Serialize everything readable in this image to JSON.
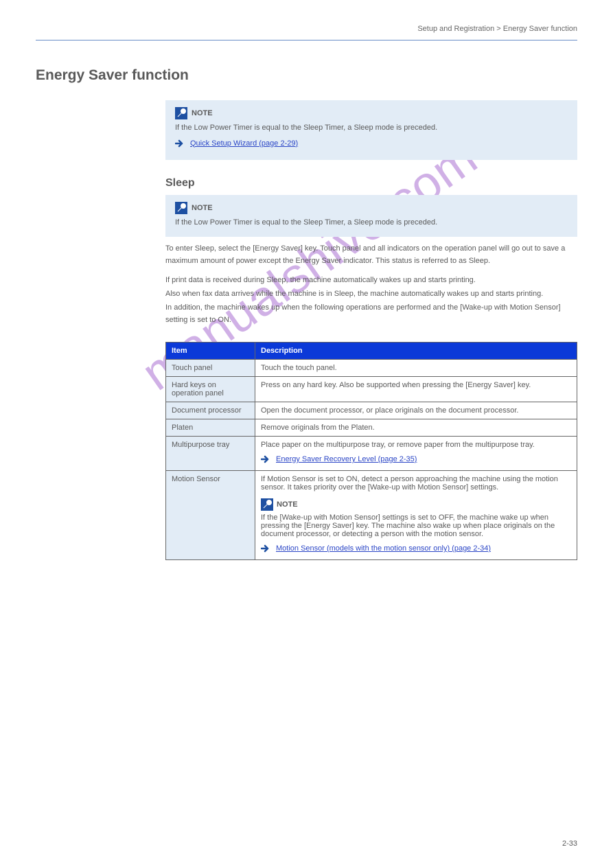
{
  "top_right": "Setup and Registration > Energy Saver function",
  "page_heading": "Energy Saver function",
  "note1": {
    "label": "NOTE",
    "body": "If the Low Power Timer is equal to the Sleep Timer, a Sleep mode is preceded.",
    "link_text": "Quick Setup Wizard (page 2-29)"
  },
  "section1_heading": "Sleep",
  "note2": {
    "label": "NOTE",
    "body": "If the Low Power Timer is equal to the Sleep Timer, a Sleep mode is preceded."
  },
  "section1_p": "To enter Sleep, select the [Energy Saver] key. Touch panel and all indicators on the operation panel will go out to save a maximum amount of power except the Energy Saver indicator. This status is referred to as Sleep.",
  "section2_p1": "If print data is received during Sleep, the machine automatically wakes up and starts printing.",
  "section2_p2": "Also when fax data arrives while the machine is in Sleep, the machine automatically wakes up and starts printing.",
  "section2_p3": "In addition, the machine wakes up when the following operations are performed and the [Wake-up with Motion Sensor] setting is set to ON.",
  "table": {
    "head_item": "Item",
    "head_desc": "Description",
    "rows": [
      {
        "item": "Touch panel",
        "desc": "Touch the touch panel."
      },
      {
        "item": "Hard keys on operation panel",
        "desc": "Press on any hard key. Also be supported when pressing the [Energy Saver] key."
      },
      {
        "item": "Document processor",
        "desc": "Open the document processor, or place originals on the document processor."
      },
      {
        "item": "Platen",
        "desc": "Remove originals from the Platen."
      },
      {
        "item": "Multipurpose tray",
        "desc": "Place paper on the multipurpose tray, or remove paper from the multipurpose tray.",
        "link": "Energy Saver Recovery Level (page 2-35)"
      },
      {
        "item": "Motion Sensor",
        "desc": "If Motion Sensor is set to ON, detect a person approaching the machine using the motion sensor. It takes priority over the [Wake-up with Motion Sensor] settings.",
        "note_label": "NOTE",
        "note_body": "If the [Wake-up with Motion Sensor] settings is set to OFF, the machine wake up when pressing the [Energy Saver] key. The machine also wake up when place originals on the document processor, or detecting a person with the motion sensor.",
        "link": "Motion Sensor (models with the motion sensor only) (page 2-34)"
      }
    ]
  },
  "watermark": "manualshive.com",
  "page_number": "2-33"
}
